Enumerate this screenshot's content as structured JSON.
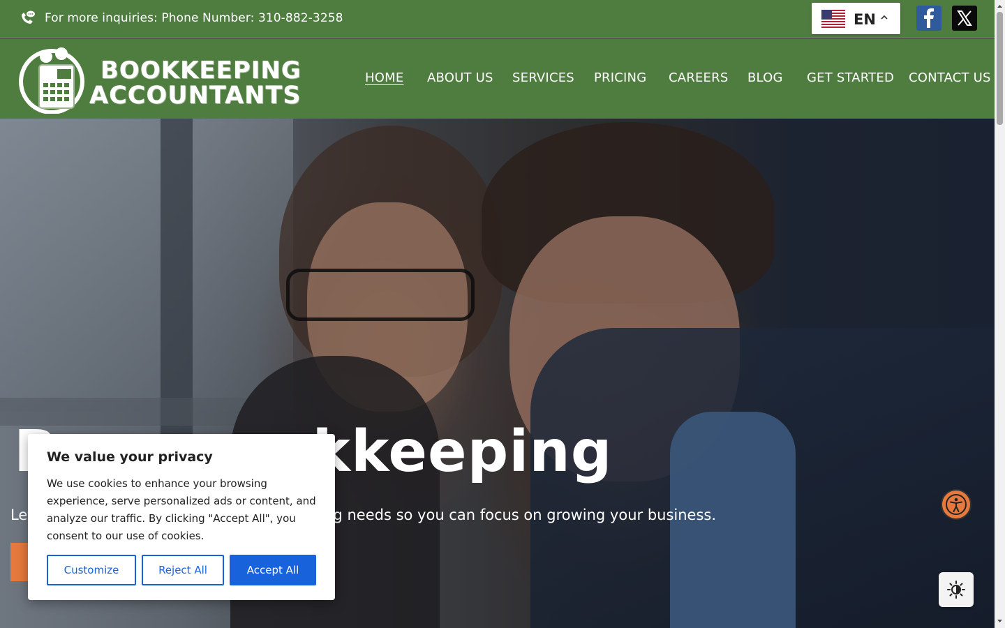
{
  "topbar": {
    "inquiry_text": "For more inquiries: Phone Number: 310-882-3258",
    "language_code": "EN",
    "social": [
      "facebook-icon",
      "x-twitter-icon"
    ]
  },
  "logo": {
    "line1": "BOOKKEEPING",
    "line2": "ACCOUNTANTS"
  },
  "nav": {
    "items": [
      {
        "label": "HOME",
        "active": true
      },
      {
        "label": "ABOUT US"
      },
      {
        "label": "SERVICES"
      },
      {
        "label": "PRICING"
      },
      {
        "label": "CAREERS"
      },
      {
        "label": "BLOG"
      },
      {
        "label": "GET STARTED"
      },
      {
        "label": "CONTACT US"
      }
    ]
  },
  "hero": {
    "title_fragment": "kkeeping",
    "title_lead": "B",
    "subtitle_lead": "Let",
    "subtitle_tail": "g needs so you can focus on growing your business."
  },
  "cookie": {
    "title": "We value your privacy",
    "body": "We use cookies to enhance your browsing experience, serve personalized ads or content, and analyze our traffic. By clicking \"Accept All\", you consent to our use of cookies.",
    "customize": "Customize",
    "reject": "Reject All",
    "accept": "Accept All"
  },
  "colors": {
    "brand_green": "#4f7d3f",
    "accent_orange": "#e6793d",
    "cookie_blue": "#1863dc"
  }
}
